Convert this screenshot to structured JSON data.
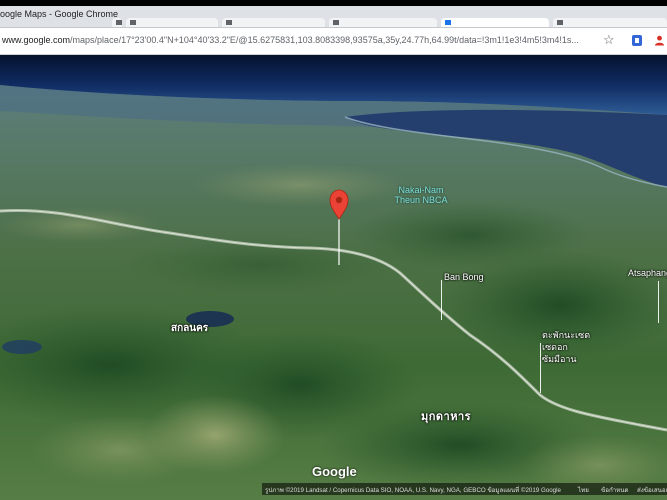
{
  "browser": {
    "tab_title": "oogle Maps - Google Chrome",
    "url_domain": "www.google.com",
    "url_path": "/maps/place/17°23'00.4\"N+104°40'33.2\"E/@15.6275831,103.8083398,93575a,35y,24.77h,64.99t/data=!3m1!1e3!4m5!3m4!1s...",
    "icons": [
      "star-icon",
      "extension-icon",
      "profile-icon"
    ]
  },
  "map": {
    "view": "satellite-3d",
    "labels": {
      "nakai_line1": "Nakai-Nam",
      "nakai_line2": "Theun NBCA",
      "ban_bong": "Ban Bong",
      "atsaphang": "Atsaphang",
      "sakon_nakhon": "สกลนคร",
      "thai_line1": "ตะพักนะเซต",
      "thai_line2": "เซดอก",
      "thai_line3": "ซัมมือาน",
      "mukdahan": "มุกดาหาร"
    },
    "logo": "Google",
    "attribution": {
      "imagery": "รูปภาพ ©2019 Landsat / Copernicus Data SIO, NOAA, U.S. Navy, NGA, GEBCO ข้อมูลแผนที่ ©2019 Google",
      "country": "ไทย",
      "terms": "ข้อกำหนด",
      "feedback": "ส่งข้อเสนอแนะ"
    },
    "colors": {
      "pin": "#ea4335",
      "sky": "#0b1f4a",
      "water": "#2c4f7a",
      "land": "#3f6b3a"
    }
  }
}
